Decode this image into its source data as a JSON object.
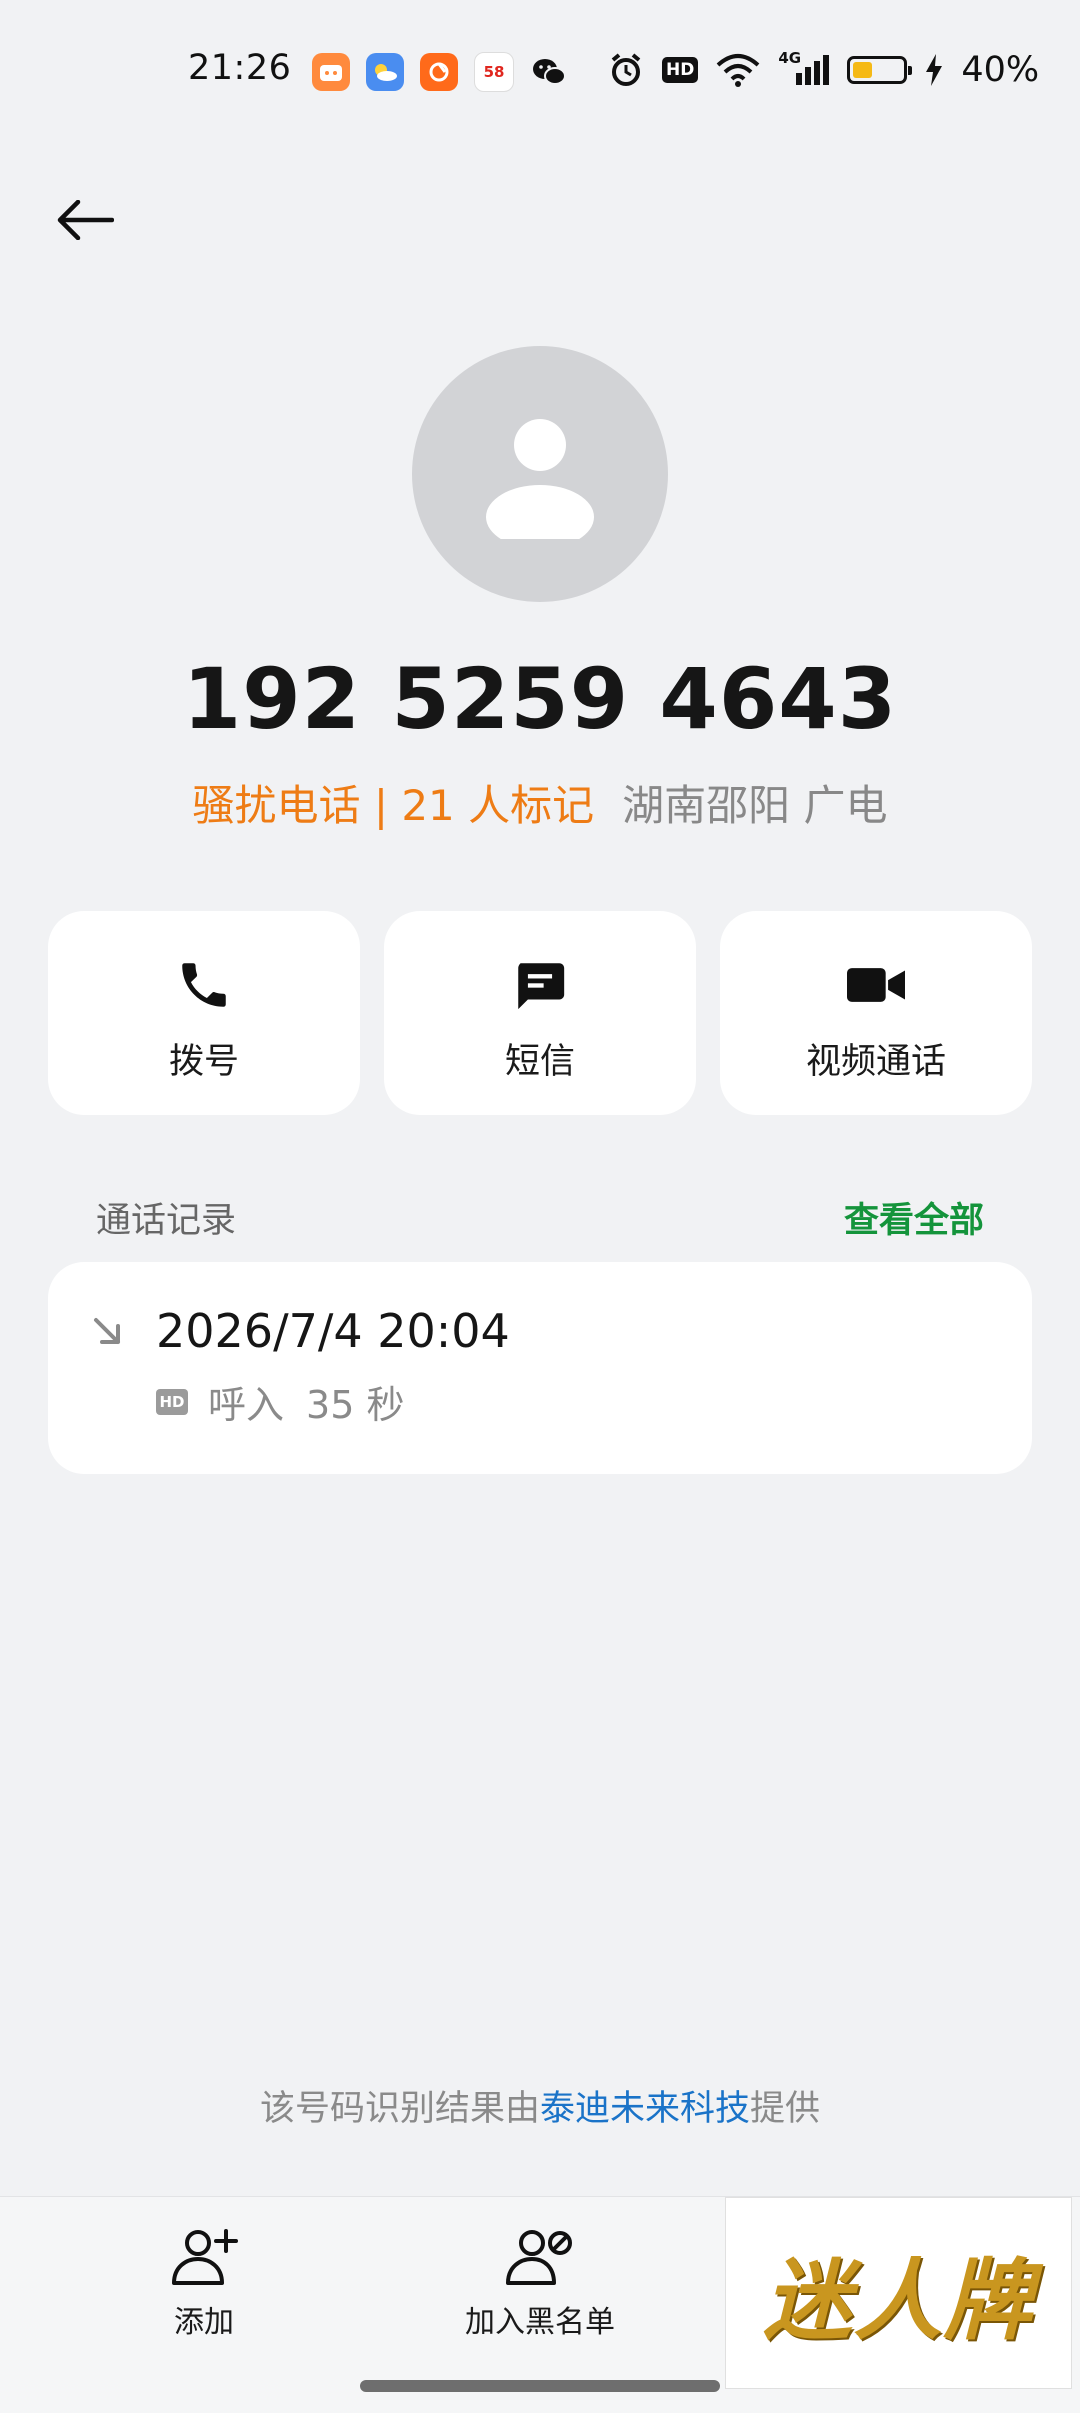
{
  "status_bar": {
    "time": "21:26",
    "app_icons": [
      "bilibili-icon",
      "weather-icon",
      "orange-app-icon",
      "58-app-icon",
      "wechat-icon"
    ],
    "hd_label": "HD",
    "network_label": "4G",
    "battery_percent": "40%",
    "battery_level": 0.4,
    "battery_color": "#f5b915"
  },
  "contact": {
    "phone_number": "192 5259 4643",
    "spam_tag": "骚扰电话 | 21 人标记",
    "location": "湖南邵阳 广电"
  },
  "actions": [
    {
      "label": "拨号",
      "icon": "phone-icon"
    },
    {
      "label": "短信",
      "icon": "message-icon"
    },
    {
      "label": "视频通话",
      "icon": "video-call-icon"
    }
  ],
  "call_history": {
    "title": "通话记录",
    "view_all": "查看全部",
    "records": [
      {
        "datetime": "2026/7/4 20:04",
        "hd": "HD",
        "type": "呼入",
        "duration": "35 秒"
      }
    ]
  },
  "footer": {
    "prefix": "该号码识别结果由",
    "provider": "泰迪未来科技",
    "suffix": "提供"
  },
  "bottom_bar": {
    "add_label": "添加",
    "blacklist_label": "加入黑名单"
  },
  "watermark_logo": "迷人牌",
  "colors": {
    "accent_orange": "#ee7c15",
    "accent_green": "#14943b",
    "link_blue": "#1a73c8",
    "background": "#f1f2f4"
  }
}
